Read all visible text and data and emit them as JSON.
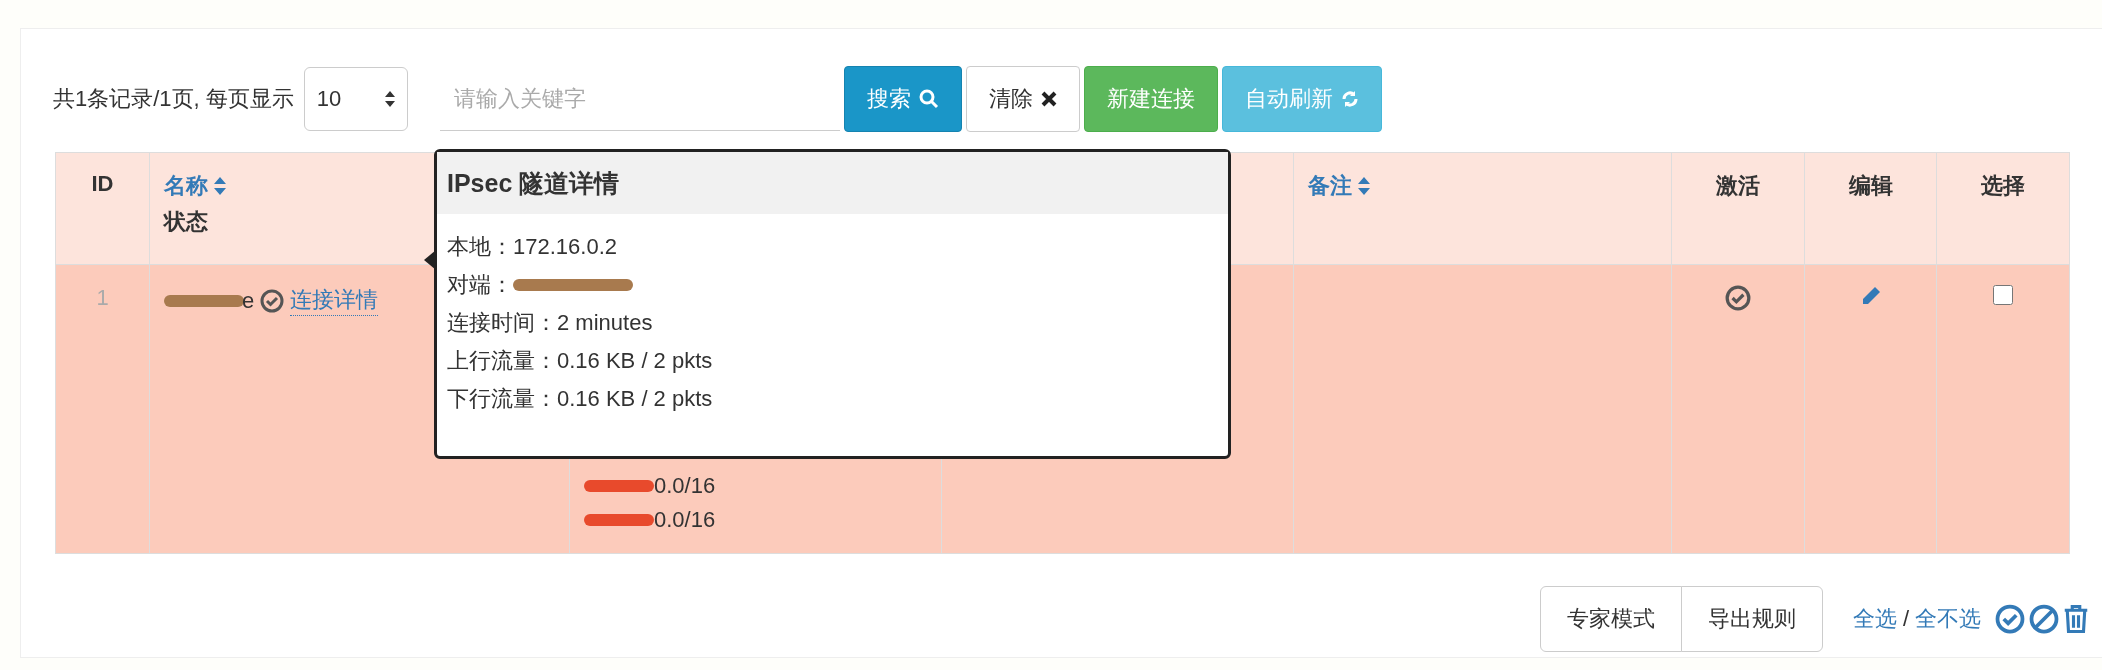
{
  "toolbar": {
    "summary": "共1条记录/1页, 每页显示",
    "page_size": "10",
    "search": {
      "placeholder": "请输入关键字"
    },
    "buttons": [
      {
        "label": "搜索",
        "kind": "search"
      },
      {
        "label": "清除",
        "kind": "clear"
      },
      {
        "label": "新建连接",
        "kind": "create"
      },
      {
        "label": "自动刷新",
        "kind": "refresh"
      }
    ]
  },
  "table": {
    "columns": [
      {
        "label": "ID",
        "sortable": false
      },
      {
        "label": "名称",
        "sub": "状态",
        "sortable": true
      },
      {},
      {},
      {
        "label": "备注",
        "sortable": true
      },
      {
        "label": "激活",
        "sortable": false
      },
      {
        "label": "编辑",
        "sortable": false
      },
      {
        "label": "选择",
        "sortable": false
      }
    ],
    "rows": [
      {
        "id": "1",
        "name": {
          "text": "e",
          "redacted": true
        },
        "online": true,
        "detail_link": "连接详情",
        "column_3": [
          {
            "text": "0.0/16",
            "redacted": true
          },
          {
            "text": "0.0/16",
            "redacted": true
          }
        ],
        "active": true,
        "checked": false
      }
    ]
  },
  "popover": {
    "title": "IPsec 隧道详情",
    "fields": [
      {
        "label": "本地：",
        "value": "172.16.0.2",
        "redacted": false
      },
      {
        "label": "对端：",
        "redacted": true
      },
      {
        "label": "连接时间：",
        "value": "2 minutes",
        "redacted": false
      },
      {
        "label": "上行流量：",
        "value": "0.16 KB / 2 pkts",
        "redacted": false
      },
      {
        "label": "下行流量：",
        "value": "0.16 KB / 2 pkts",
        "redacted": false
      }
    ]
  },
  "footer": {
    "buttons": [
      "专家模式",
      "导出规则"
    ],
    "links": [
      "全选",
      "全不选"
    ],
    "separator": "/"
  }
}
